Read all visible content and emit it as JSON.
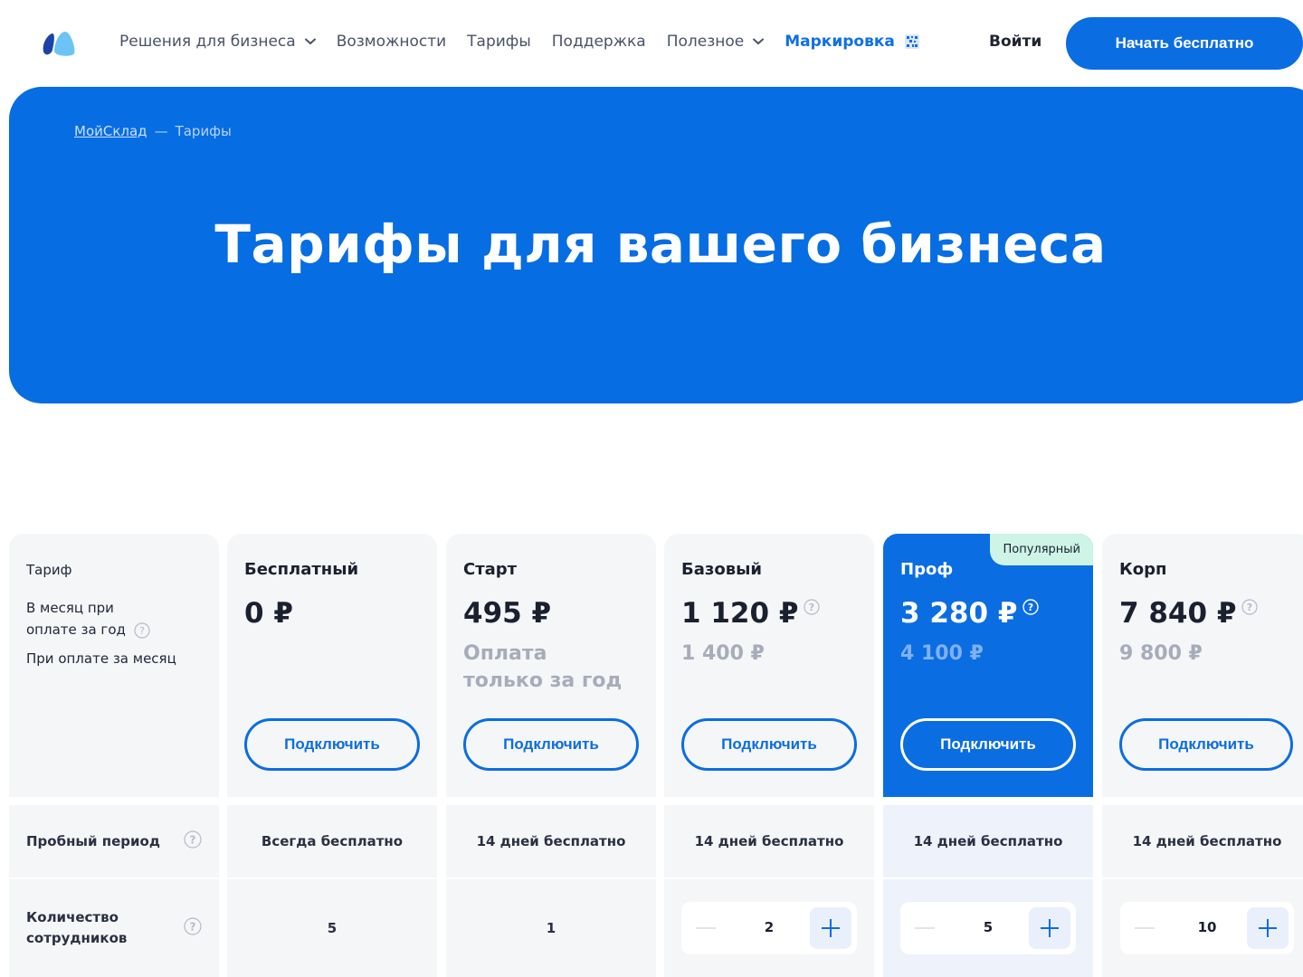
{
  "header": {
    "nav": [
      {
        "label": "Решения для бизнеса",
        "dropdown": true
      },
      {
        "label": "Возможности",
        "dropdown": false
      },
      {
        "label": "Тарифы",
        "dropdown": false
      },
      {
        "label": "Поддержка",
        "dropdown": false
      },
      {
        "label": "Полезное",
        "dropdown": true
      }
    ],
    "marking_label": "Маркировка",
    "login_label": "Войти",
    "cta_label": "Начать бесплатно",
    "accent_color": "#0b6de2"
  },
  "hero": {
    "breadcrumb_home": "МойСклад",
    "breadcrumb_sep": "—",
    "breadcrumb_current": "Тарифы",
    "title": "Тарифы для вашего бизнеса"
  },
  "pricing": {
    "labels": {
      "tariff": "Тариф",
      "yearly_line1": "В месяц при",
      "yearly_line2": "оплате за год",
      "monthly": "При оплате за месяц"
    },
    "connect_label": "Подключить",
    "popular_badge": "Популярный",
    "plans": [
      {
        "name": "Бесплатный",
        "price": "0 ₽",
        "sub": "",
        "help": false
      },
      {
        "name": "Старт",
        "price": "495 ₽",
        "sub": "Оплата только за год",
        "help": false
      },
      {
        "name": "Базовый",
        "price": "1 120 ₽",
        "sub": "1 400 ₽",
        "help": true
      },
      {
        "name": "Проф",
        "price": "3 280 ₽",
        "sub": "4 100 ₽",
        "help": true
      },
      {
        "name": "Корп",
        "price": "7 840 ₽",
        "sub": "9 800 ₽",
        "help": true
      }
    ]
  },
  "features": {
    "trial": {
      "label": "Пробный период",
      "values": [
        "Всегда бесплатно",
        "14 дней бесплатно",
        "14 дней бесплатно",
        "14 дней бесплатно",
        "14 дней бесплатно"
      ]
    },
    "employees": {
      "label_line1": "Количество",
      "label_line2": "сотрудников",
      "values": [
        "5",
        "1",
        "2",
        "5",
        "10"
      ]
    }
  }
}
